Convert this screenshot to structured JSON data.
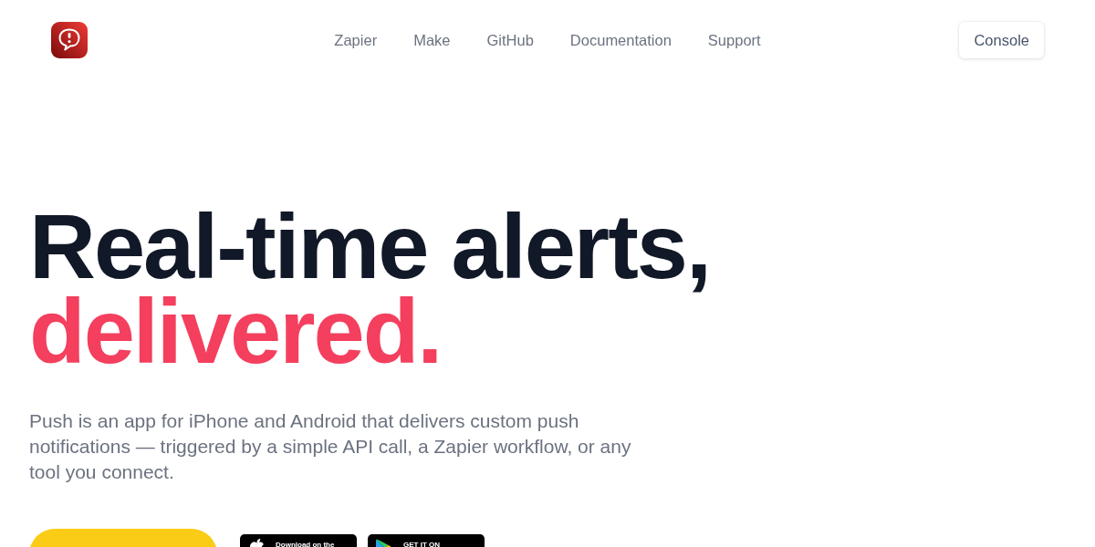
{
  "header": {
    "nav": [
      {
        "label": "Zapier"
      },
      {
        "label": "Make"
      },
      {
        "label": "GitHub"
      },
      {
        "label": "Documentation"
      },
      {
        "label": "Support"
      }
    ],
    "console_button": {
      "label": "Console"
    }
  },
  "hero": {
    "headline": "Real-time alerts,",
    "headline_accent": "delivered.",
    "description": "Push is an app for iPhone and Android that delivers custom push notifications — triggered by a simple API call, a Zapier workflow, or any tool you connect.",
    "store_badges": [
      {
        "kind": "app_store",
        "label": "Download on the"
      },
      {
        "kind": "google_play",
        "label": "GET IT ON"
      }
    ]
  }
}
